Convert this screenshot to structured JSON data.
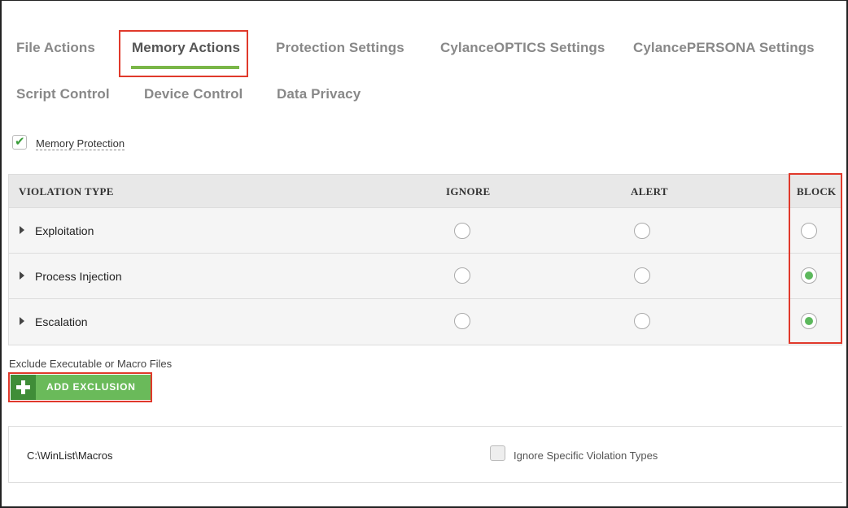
{
  "tabs": [
    {
      "label": "File Actions",
      "active": false
    },
    {
      "label": "Memory Actions",
      "active": true
    },
    {
      "label": "Protection Settings",
      "active": false
    },
    {
      "label": "CylanceOPTICS Settings",
      "active": false
    },
    {
      "label": "CylancePERSONA Settings",
      "active": false
    },
    {
      "label": "Script Control",
      "active": false
    },
    {
      "label": "Device Control",
      "active": false
    },
    {
      "label": "Data Privacy",
      "active": false
    }
  ],
  "memory_protection": {
    "label": "Memory Protection",
    "checked": true
  },
  "table": {
    "headers": [
      "VIOLATION TYPE",
      "IGNORE",
      "ALERT",
      "BLOCK"
    ],
    "rows": [
      {
        "label": "Exploitation",
        "selected": "none"
      },
      {
        "label": "Process Injection",
        "selected": "BLOCK"
      },
      {
        "label": "Escalation",
        "selected": "BLOCK"
      }
    ]
  },
  "exclusions": {
    "section_label": "Exclude Executable or Macro Files",
    "add_button_label": "ADD EXCLUSION",
    "items": [
      {
        "path": "C:\\WinList\\Macros",
        "ignore_label": "Ignore Specific Violation Types",
        "ignore_checked": false
      }
    ]
  },
  "colors": {
    "accent_green": "#7ab648",
    "button_green": "#6aba5a",
    "highlight_red": "#e0392b"
  }
}
